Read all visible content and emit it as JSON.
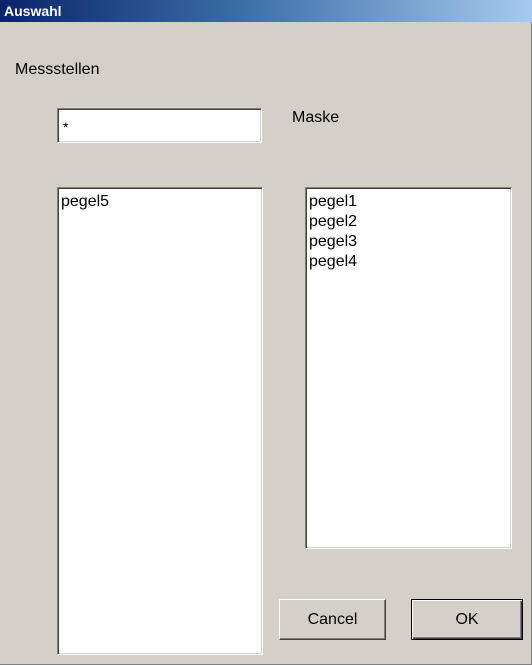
{
  "window": {
    "title": "Auswahl"
  },
  "labels": {
    "section": "Messstellen",
    "mask": "Maske"
  },
  "mask_input": {
    "value": "*"
  },
  "left_list": {
    "items": [
      "pegel5"
    ]
  },
  "right_list": {
    "items": [
      "pegel1",
      "pegel2",
      "pegel3",
      "pegel4"
    ]
  },
  "buttons": {
    "cancel": "Cancel",
    "ok": "OK"
  },
  "colors": {
    "face": "#d4d0c8",
    "titlebar_start": "#0a246a",
    "titlebar_end": "#a6caf0",
    "field": "#ffffff"
  }
}
